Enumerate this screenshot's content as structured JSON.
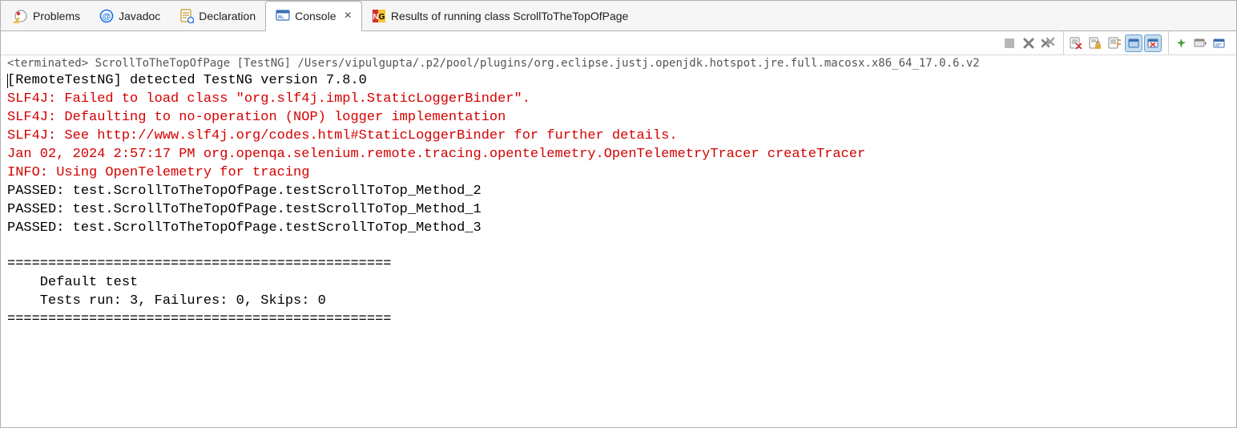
{
  "tabs": [
    {
      "label": "Problems"
    },
    {
      "label": "Javadoc"
    },
    {
      "label": "Declaration"
    },
    {
      "label": "Console"
    },
    {
      "label": "Results of running class ScrollToTheTopOfPage"
    }
  ],
  "status": "<terminated> ScrollToTheTopOfPage [TestNG] /Users/vipulgupta/.p2/pool/plugins/org.eclipse.justj.openjdk.hotspot.jre.full.macosx.x86_64_17.0.6.v2",
  "console_lines": [
    {
      "color": "black",
      "text": "[RemoteTestNG] detected TestNG version 7.8.0"
    },
    {
      "color": "red",
      "text": "SLF4J: Failed to load class \"org.slf4j.impl.StaticLoggerBinder\"."
    },
    {
      "color": "red",
      "text": "SLF4J: Defaulting to no-operation (NOP) logger implementation"
    },
    {
      "color": "red",
      "text": "SLF4J: See http://www.slf4j.org/codes.html#StaticLoggerBinder for further details."
    },
    {
      "color": "red",
      "text": "Jan 02, 2024 2:57:17 PM org.openqa.selenium.remote.tracing.opentelemetry.OpenTelemetryTracer createTracer"
    },
    {
      "color": "red",
      "text": "INFO: Using OpenTelemetry for tracing"
    },
    {
      "color": "black",
      "text": "PASSED: test.ScrollToTheTopOfPage.testScrollToTop_Method_2"
    },
    {
      "color": "black",
      "text": "PASSED: test.ScrollToTheTopOfPage.testScrollToTop_Method_1"
    },
    {
      "color": "black",
      "text": "PASSED: test.ScrollToTheTopOfPage.testScrollToTop_Method_3"
    },
    {
      "color": "black",
      "text": ""
    },
    {
      "color": "black",
      "text": "==============================================="
    },
    {
      "color": "black",
      "text": "    Default test"
    },
    {
      "color": "black",
      "text": "    Tests run: 3, Failures: 0, Skips: 0"
    },
    {
      "color": "black",
      "text": "==============================================="
    }
  ]
}
